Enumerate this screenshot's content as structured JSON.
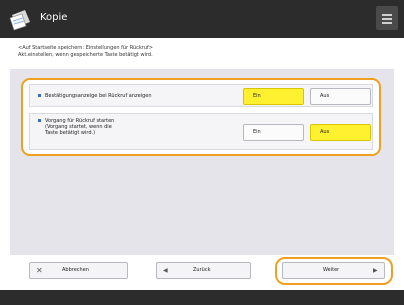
{
  "app": {
    "title": "Kopie",
    "icon": "copy-app-icon",
    "menu_icon": "menu-icon"
  },
  "description": {
    "line1": "<Auf Startseite speichern: Einstellungen für Rückruf>",
    "line2": "Akt.einstellen, wenn gespeicherte Taste betätigt wird."
  },
  "settings": [
    {
      "label_lines": [
        "Bestätigungsanzeige bei Rückruf anzeigen"
      ],
      "options": [
        "Ein",
        "Aus"
      ],
      "selected": "Ein"
    },
    {
      "label_lines": [
        "Vorgang für Rückruf starten",
        "(Vorgang startet, wenn die",
        "Taste betätigt wird.)"
      ],
      "options": [
        "Ein",
        "Aus"
      ],
      "selected": "Aus"
    }
  ],
  "footer": {
    "cancel_label": "Abbrechen",
    "back_label": "Zurück",
    "next_label": "Weiter",
    "cancel_icon": "x-icon",
    "back_icon": "arrow-left-icon",
    "next_icon": "arrow-right-icon"
  },
  "colors": {
    "highlight": "#f0a020",
    "selected": "#fff130",
    "titlebar": "#2c2c2c",
    "bullet": "#3a6fc4"
  }
}
